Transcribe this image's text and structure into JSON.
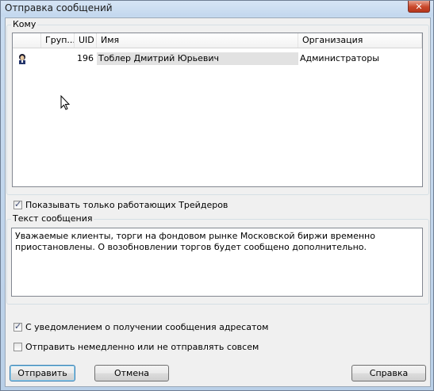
{
  "window": {
    "title": "Отправка сообщений"
  },
  "recipients": {
    "group_title": "Кому",
    "columns": [
      "",
      "Груп...",
      "UID",
      "Имя",
      "Организация"
    ],
    "rows": [
      {
        "icon": "user-icon",
        "group": "",
        "uid": "196",
        "name": "Тоблер Дмитрий Юрьевич",
        "organization": "Администраторы"
      }
    ]
  },
  "options": {
    "only_working_traders": {
      "label": "Показывать только работающих Трейдеров",
      "checked": true
    },
    "read_receipt": {
      "label": "С уведомлением о получении сообщения адресатом",
      "checked": true
    },
    "send_now_or_never": {
      "label": "Отправить немедленно или не отправлять совсем",
      "checked": false
    }
  },
  "message": {
    "group_title": "Текст сообщения",
    "text": "Уважаемые клиенты, торги на фондовом рынке Московской биржи временно приостановлены. О возобновлении торгов будет сообщено дополнительно."
  },
  "buttons": {
    "send": "Отправить",
    "cancel": "Отмена",
    "help": "Справка"
  },
  "colors": {
    "close_button": "#c9472a",
    "title_bar": "#c3d7ee",
    "dialog_bg": "#f0f0f0"
  }
}
